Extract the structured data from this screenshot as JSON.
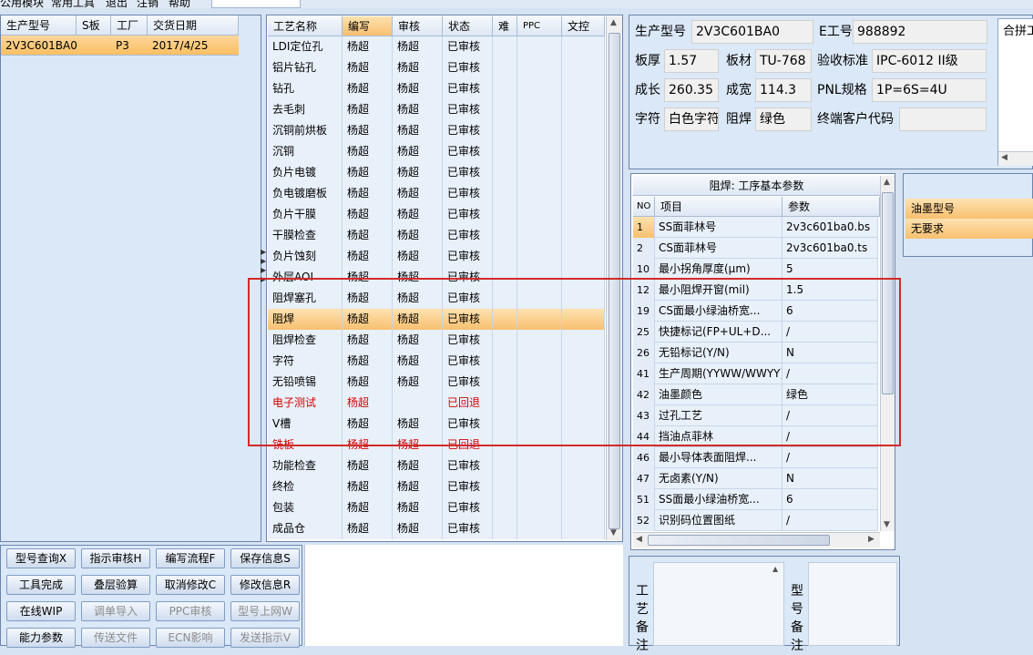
{
  "menu": [
    "公用模块",
    "常用工具",
    "退出",
    "注销",
    "帮助"
  ],
  "left_table": {
    "headers": [
      "生产型号",
      "S板",
      "工厂",
      "交货日期"
    ],
    "rows": [
      {
        "model": "2V3C601BA0",
        "s": "",
        "factory": "P3",
        "date": "2017/4/25"
      }
    ]
  },
  "process_table": {
    "headers": [
      "工艺名称",
      "编写",
      "审核",
      "状态",
      "难",
      "PPC",
      "文控"
    ],
    "rows": [
      {
        "name": "LDI定位孔",
        "writer": "杨超",
        "reviewer": "杨超",
        "status": "已审核"
      },
      {
        "name": "铝片钻孔",
        "writer": "杨超",
        "reviewer": "杨超",
        "status": "已审核"
      },
      {
        "name": "钻孔",
        "writer": "杨超",
        "reviewer": "杨超",
        "status": "已审核"
      },
      {
        "name": "去毛刺",
        "writer": "杨超",
        "reviewer": "杨超",
        "status": "已审核"
      },
      {
        "name": "沉铜前烘板",
        "writer": "杨超",
        "reviewer": "杨超",
        "status": "已审核"
      },
      {
        "name": "沉铜",
        "writer": "杨超",
        "reviewer": "杨超",
        "status": "已审核"
      },
      {
        "name": "负片电镀",
        "writer": "杨超",
        "reviewer": "杨超",
        "status": "已审核"
      },
      {
        "name": "负电镀磨板",
        "writer": "杨超",
        "reviewer": "杨超",
        "status": "已审核"
      },
      {
        "name": "负片干膜",
        "writer": "杨超",
        "reviewer": "杨超",
        "status": "已审核"
      },
      {
        "name": "干膜检查",
        "writer": "杨超",
        "reviewer": "杨超",
        "status": "已审核"
      },
      {
        "name": "负片蚀刻",
        "writer": "杨超",
        "reviewer": "杨超",
        "status": "已审核"
      },
      {
        "name": "外层AOI",
        "writer": "杨超",
        "reviewer": "杨超",
        "status": "已审核"
      },
      {
        "name": "阻焊塞孔",
        "writer": "杨超",
        "reviewer": "杨超",
        "status": "已审核"
      },
      {
        "name": "阻焊",
        "writer": "杨超",
        "reviewer": "杨超",
        "status": "已审核",
        "selected": true
      },
      {
        "name": "阻焊检查",
        "writer": "杨超",
        "reviewer": "杨超",
        "status": "已审核"
      },
      {
        "name": "字符",
        "writer": "杨超",
        "reviewer": "杨超",
        "status": "已审核"
      },
      {
        "name": "无铅喷锡",
        "writer": "杨超",
        "reviewer": "杨超",
        "status": "已审核"
      },
      {
        "name": "电子测试",
        "writer": "杨超",
        "reviewer": "",
        "status": "已回退",
        "red": true
      },
      {
        "name": "V槽",
        "writer": "杨超",
        "reviewer": "杨超",
        "status": "已审核"
      },
      {
        "name": "铣板",
        "writer": "杨超",
        "reviewer": "杨超",
        "status": "已回退",
        "red": true
      },
      {
        "name": "功能检查",
        "writer": "杨超",
        "reviewer": "杨超",
        "status": "已审核"
      },
      {
        "name": "终检",
        "writer": "杨超",
        "reviewer": "杨超",
        "status": "已审核"
      },
      {
        "name": "包装",
        "writer": "杨超",
        "reviewer": "杨超",
        "status": "已审核"
      },
      {
        "name": "成品仓",
        "writer": "杨超",
        "reviewer": "杨超",
        "status": "已审核"
      }
    ]
  },
  "buttons": [
    {
      "label": "型号查询X",
      "enabled": true
    },
    {
      "label": "指示审核H",
      "enabled": true
    },
    {
      "label": "编写流程F",
      "enabled": true
    },
    {
      "label": "保存信息S",
      "enabled": true
    },
    {
      "label": "工具完成",
      "enabled": true
    },
    {
      "label": "叠层验算",
      "enabled": true
    },
    {
      "label": "取消修改C",
      "enabled": true
    },
    {
      "label": "修改信息R",
      "enabled": true
    },
    {
      "label": "在线WIP",
      "enabled": true
    },
    {
      "label": "调单导入",
      "enabled": false
    },
    {
      "label": "PPC审核",
      "enabled": false
    },
    {
      "label": "型号上网W",
      "enabled": false
    },
    {
      "label": "能力参数",
      "enabled": true
    },
    {
      "label": "传送文件",
      "enabled": false
    },
    {
      "label": "ECN影响",
      "enabled": false
    },
    {
      "label": "发送指示V",
      "enabled": false
    }
  ],
  "info": {
    "model_label": "生产型号",
    "model": "2V3C601BA0",
    "eno_label": "E工号",
    "eno": "988892",
    "thick_label": "板厚",
    "thick": "1.57",
    "mat_label": "板材",
    "mat": "TU-768",
    "std_label": "验收标准",
    "std": "IPC-6012 II级",
    "len_label": "成长",
    "len": "260.35",
    "wid_label": "成宽",
    "wid": "114.3",
    "pnl_label": "PNL规格",
    "pnl": "1P=6S=4U",
    "char_label": "字符",
    "char": "白色字符",
    "sm_label": "阻焊",
    "sm": "绿色",
    "cust_label": "终端客户代码",
    "cust": "",
    "side_tab": "合拼工"
  },
  "params": {
    "title": "阻焊: 工序基本参数",
    "headers": [
      "NO",
      "项目",
      "参数"
    ],
    "rows": [
      {
        "no": "1",
        "item": "SS面菲林号",
        "val": "2v3c601ba0.bs",
        "selected": true
      },
      {
        "no": "2",
        "item": "CS面菲林号",
        "val": "2v3c601ba0.ts"
      },
      {
        "no": "10",
        "item": "最小拐角厚度(μm)",
        "val": "5"
      },
      {
        "no": "12",
        "item": "最小阻焊开窗(mil)",
        "val": "1.5"
      },
      {
        "no": "19",
        "item": "CS面最小绿油桥宽...",
        "val": "6"
      },
      {
        "no": "25",
        "item": "快捷标记(FP+UL+D...",
        "val": "/"
      },
      {
        "no": "26",
        "item": "无铅标记(Y/N)",
        "val": "N"
      },
      {
        "no": "41",
        "item": "生产周期(YYWW/WWYY)",
        "val": "/"
      },
      {
        "no": "42",
        "item": "油墨颜色",
        "val": "绿色"
      },
      {
        "no": "43",
        "item": "过孔工艺",
        "val": "/"
      },
      {
        "no": "44",
        "item": "挡油点菲林",
        "val": "/"
      },
      {
        "no": "46",
        "item": "最小导体表面阻焊...",
        "val": "/"
      },
      {
        "no": "47",
        "item": "无卤素(Y/N)",
        "val": "N"
      },
      {
        "no": "51",
        "item": "SS面最小绿油桥宽...",
        "val": "6"
      },
      {
        "no": "52",
        "item": "识别码位置图纸",
        "val": "/"
      }
    ]
  },
  "ink": {
    "header": "油墨型号",
    "value": "无要求"
  },
  "remarks": {
    "process_label": [
      "工",
      "艺",
      "备",
      "注"
    ],
    "model_label": [
      "型",
      "号",
      "备",
      "注"
    ]
  },
  "colors": {
    "accent_selected": "#f8c070",
    "error_red": "#d40000",
    "highlight_box": "#d22a2a"
  }
}
